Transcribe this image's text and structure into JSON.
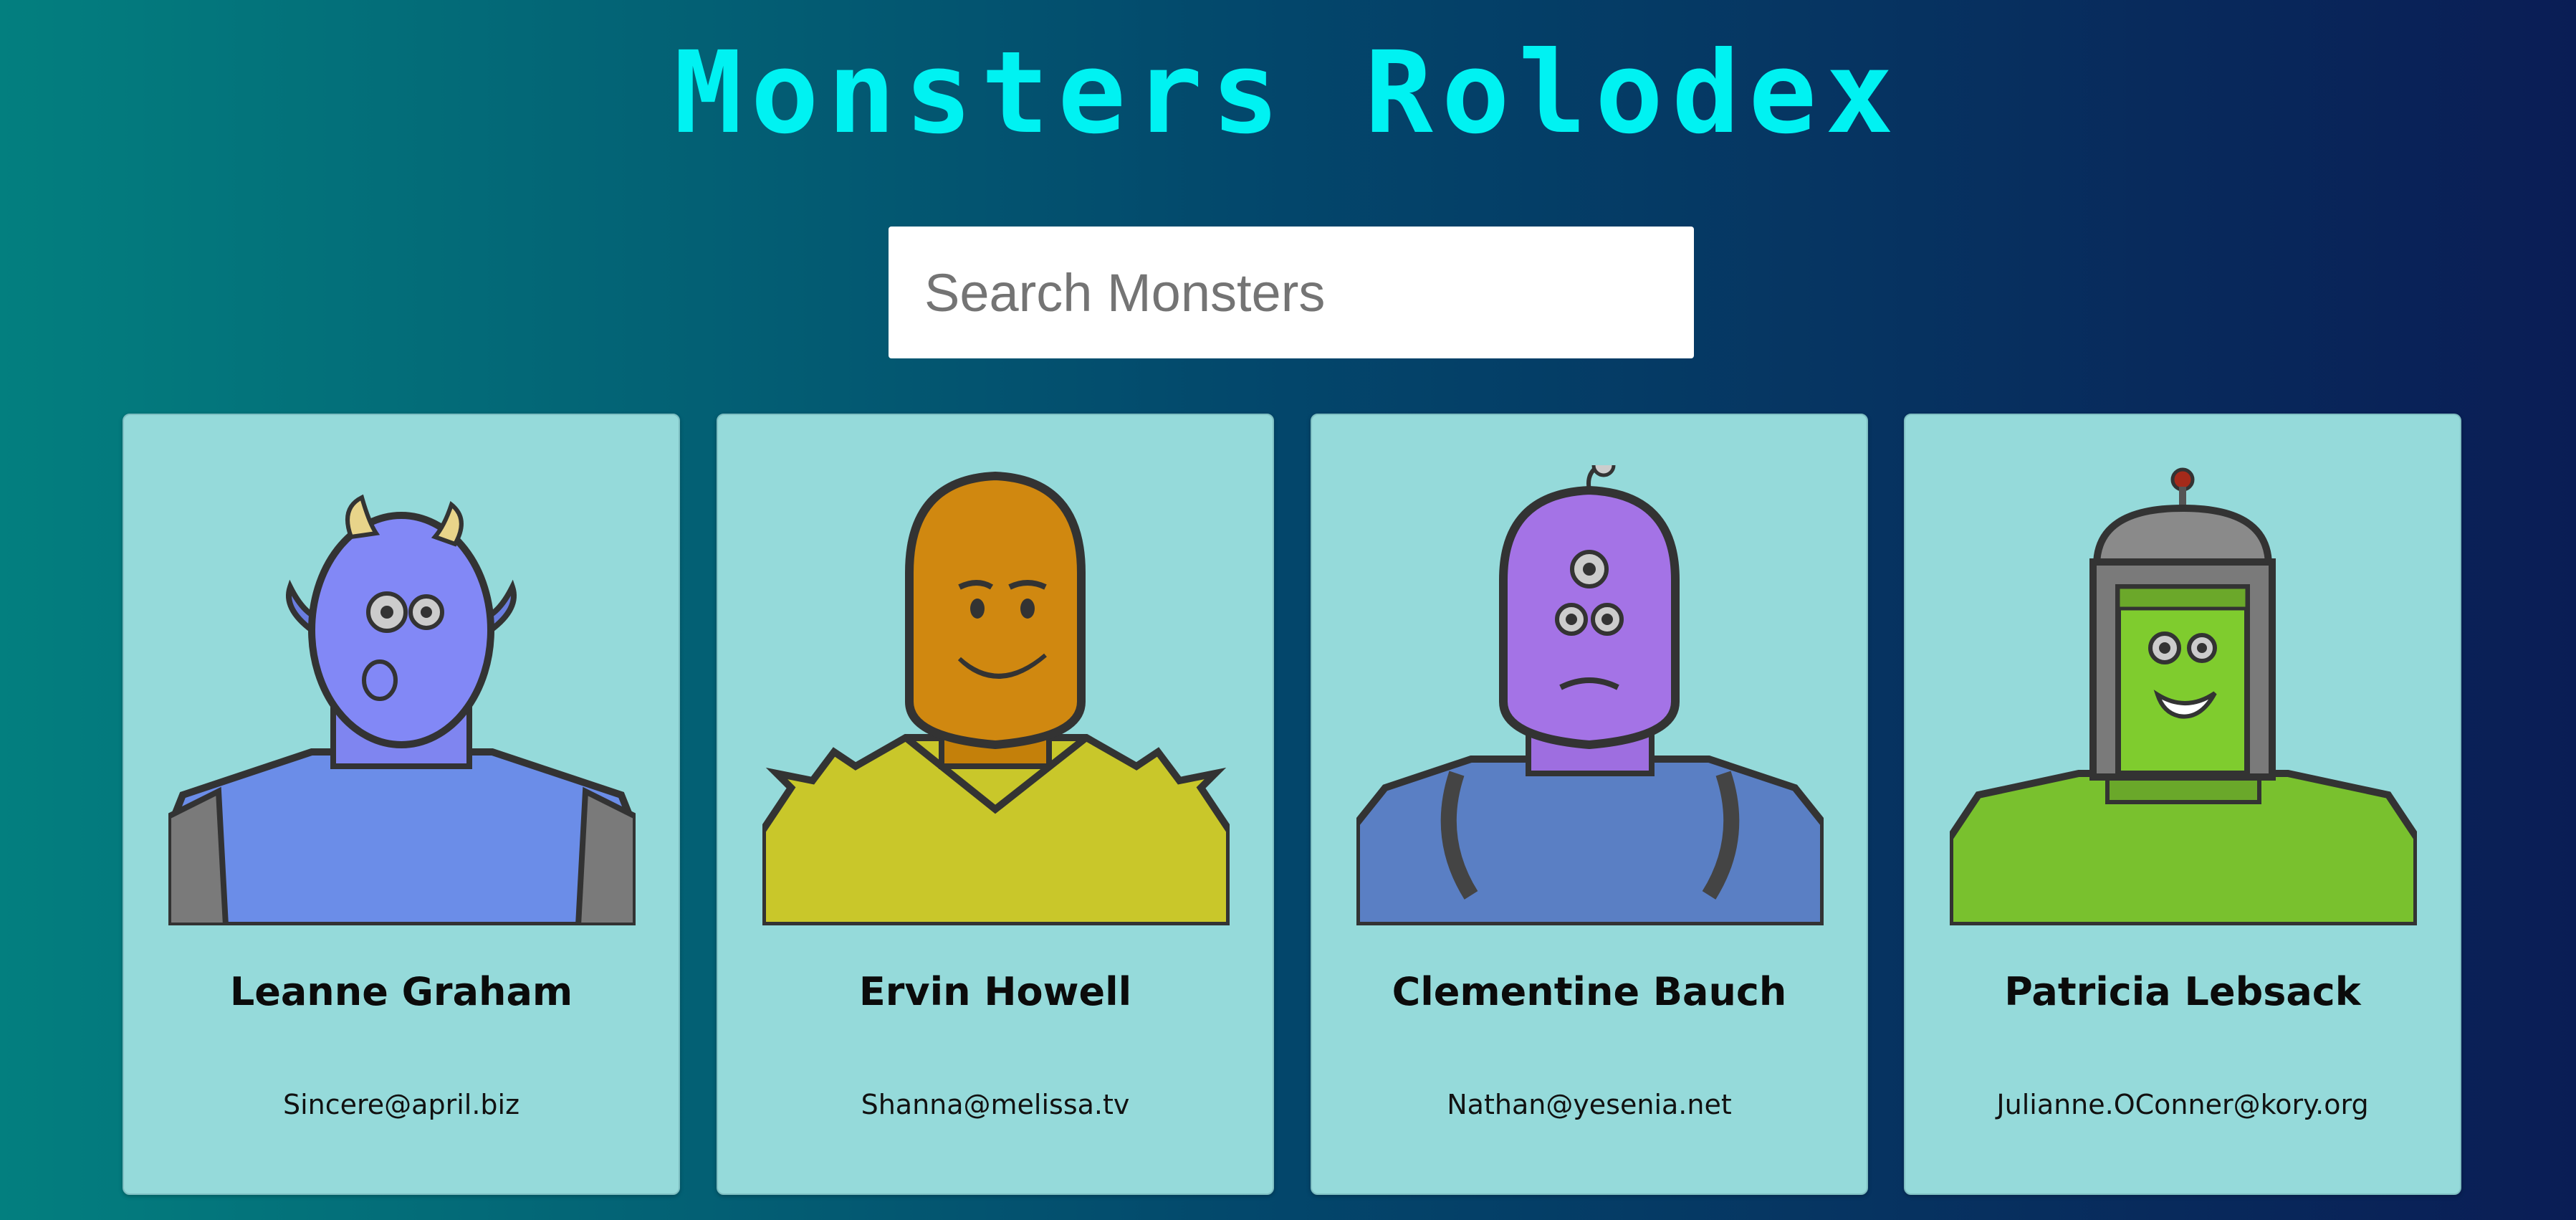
{
  "header": {
    "title": "Monsters Rolodex"
  },
  "search": {
    "placeholder": "Search Monsters",
    "value": ""
  },
  "monsters": [
    {
      "name": "Leanne Graham",
      "email": "Sincere@april.biz",
      "icon": "blue-horned-monster-avatar-icon"
    },
    {
      "name": "Ervin Howell",
      "email": "Shanna@melissa.tv",
      "icon": "orange-spiky-monster-avatar-icon"
    },
    {
      "name": "Clementine Bauch",
      "email": "Nathan@yesenia.net",
      "icon": "purple-three-eyed-monster-avatar-icon"
    },
    {
      "name": "Patricia Lebsack",
      "email": "Julianne.OConner@kory.org",
      "icon": "green-robot-helmet-monster-avatar-icon"
    }
  ]
}
